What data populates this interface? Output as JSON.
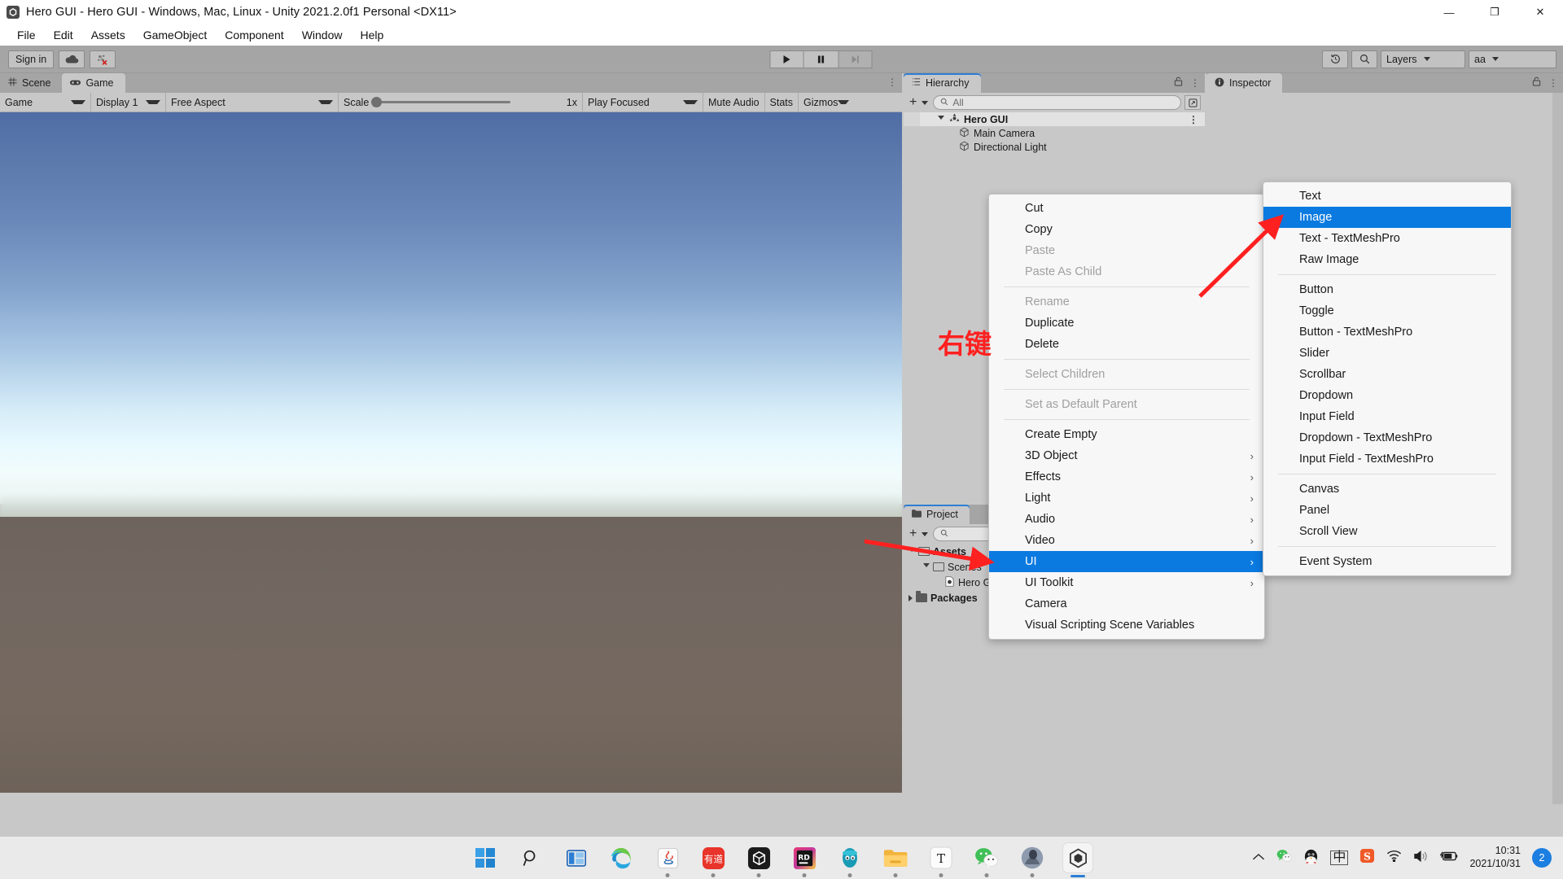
{
  "window": {
    "title": "Hero GUI - Hero GUI - Windows, Mac, Linux - Unity 2021.2.0f1 Personal <DX11>",
    "app_icon": "unity-icon",
    "minimize": "—",
    "maximize": "❐",
    "close": "✕"
  },
  "menubar": {
    "items": [
      {
        "label": "File"
      },
      {
        "label": "Edit"
      },
      {
        "label": "Assets"
      },
      {
        "label": "GameObject"
      },
      {
        "label": "Component"
      },
      {
        "label": "Window"
      },
      {
        "label": "Help"
      }
    ]
  },
  "toolbar": {
    "signin_label": "Sign in",
    "cloud_icon": "cloud-icon",
    "collab_icon": "collab-error-icon",
    "play_icon": "play-icon",
    "pause_icon": "pause-icon",
    "step_icon": "step-icon",
    "history_icon": "undo-history-icon",
    "search_icon": "search-icon",
    "layers_label": "Layers",
    "layout_label": "aa"
  },
  "game_view": {
    "tabs": [
      {
        "label": "Scene",
        "icon": "grid-icon",
        "active": false
      },
      {
        "label": "Game",
        "icon": "gamepad-icon",
        "active": true
      }
    ],
    "toolbar": {
      "target_display_mode": "Game",
      "display": "Display 1",
      "aspect": "Free Aspect",
      "scale_label": "Scale",
      "scale_value": "1x",
      "play_mode": "Play Focused",
      "mute_audio": "Mute Audio",
      "stats": "Stats",
      "gizmos": "Gizmos"
    },
    "sky_color_top": "#4f6da5",
    "sky_color_horizon": "#eafaff",
    "ground_color": "#726761"
  },
  "hierarchy": {
    "tab_label": "Hierarchy",
    "tab_icon": "hierarchy-icon",
    "lock_icon": "lock-icon",
    "menu_icon": "kebab-icon",
    "add_label": "+",
    "search_placeholder": "All",
    "items": [
      {
        "label": "Hero GUI",
        "icon": "scene-icon",
        "depth": 0,
        "expanded": true,
        "is_scene": true
      },
      {
        "label": "Main Camera",
        "icon": "gameobject-icon",
        "depth": 1,
        "expanded": false,
        "is_scene": false
      },
      {
        "label": "Directional Light",
        "icon": "gameobject-icon",
        "depth": 1,
        "expanded": false,
        "is_scene": false
      }
    ]
  },
  "project": {
    "tab_label": "Project",
    "tab_icon": "folder-icon",
    "add_label": "+",
    "search_placeholder": "",
    "items": [
      {
        "label": "Assets",
        "depth": 0,
        "expanded": true,
        "icon": "folder-open-icon"
      },
      {
        "label": "Scenes",
        "depth": 1,
        "expanded": true,
        "icon": "folder-open-icon"
      },
      {
        "label": "Hero GUI",
        "depth": 2,
        "expanded": false,
        "icon": "unity-scene-asset-icon"
      },
      {
        "label": "Packages",
        "depth": 0,
        "expanded": false,
        "icon": "folder-icon"
      }
    ]
  },
  "inspector": {
    "tab_label": "Inspector",
    "tab_icon": "info-icon",
    "lock_icon": "lock-icon",
    "menu_icon": "kebab-icon"
  },
  "context_menu": {
    "items": [
      {
        "label": "Cut",
        "enabled": true,
        "submenu": false,
        "selected": false
      },
      {
        "label": "Copy",
        "enabled": true,
        "submenu": false,
        "selected": false
      },
      {
        "label": "Paste",
        "enabled": false,
        "submenu": false,
        "selected": false
      },
      {
        "label": "Paste As Child",
        "enabled": false,
        "submenu": false,
        "selected": false
      },
      {
        "separator": true
      },
      {
        "label": "Rename",
        "enabled": false,
        "submenu": false,
        "selected": false
      },
      {
        "label": "Duplicate",
        "enabled": true,
        "submenu": false,
        "selected": false
      },
      {
        "label": "Delete",
        "enabled": true,
        "submenu": false,
        "selected": false
      },
      {
        "separator": true
      },
      {
        "label": "Select Children",
        "enabled": false,
        "submenu": false,
        "selected": false
      },
      {
        "separator": true
      },
      {
        "label": "Set as Default Parent",
        "enabled": false,
        "submenu": false,
        "selected": false
      },
      {
        "separator": true
      },
      {
        "label": "Create Empty",
        "enabled": true,
        "submenu": false,
        "selected": false
      },
      {
        "label": "3D Object",
        "enabled": true,
        "submenu": true,
        "selected": false
      },
      {
        "label": "Effects",
        "enabled": true,
        "submenu": true,
        "selected": false
      },
      {
        "label": "Light",
        "enabled": true,
        "submenu": true,
        "selected": false
      },
      {
        "label": "Audio",
        "enabled": true,
        "submenu": true,
        "selected": false
      },
      {
        "label": "Video",
        "enabled": true,
        "submenu": true,
        "selected": false
      },
      {
        "label": "UI",
        "enabled": true,
        "submenu": true,
        "selected": true
      },
      {
        "label": "UI Toolkit",
        "enabled": true,
        "submenu": true,
        "selected": false
      },
      {
        "label": "Camera",
        "enabled": true,
        "submenu": false,
        "selected": false
      },
      {
        "label": "Visual Scripting Scene Variables",
        "enabled": true,
        "submenu": false,
        "selected": false
      }
    ]
  },
  "ui_submenu": {
    "items": [
      {
        "label": "Text",
        "selected": false
      },
      {
        "label": "Image",
        "selected": true
      },
      {
        "label": "Text - TextMeshPro",
        "selected": false
      },
      {
        "label": "Raw Image",
        "selected": false
      },
      {
        "separator": true
      },
      {
        "label": "Button",
        "selected": false
      },
      {
        "label": "Toggle",
        "selected": false
      },
      {
        "label": "Button - TextMeshPro",
        "selected": false
      },
      {
        "label": "Slider",
        "selected": false
      },
      {
        "label": "Scrollbar",
        "selected": false
      },
      {
        "label": "Dropdown",
        "selected": false
      },
      {
        "label": "Input Field",
        "selected": false
      },
      {
        "label": "Dropdown - TextMeshPro",
        "selected": false
      },
      {
        "label": "Input Field - TextMeshPro",
        "selected": false
      },
      {
        "separator": true
      },
      {
        "label": "Canvas",
        "selected": false
      },
      {
        "label": "Panel",
        "selected": false
      },
      {
        "label": "Scroll View",
        "selected": false
      },
      {
        "separator": true
      },
      {
        "label": "Event System",
        "selected": false
      }
    ]
  },
  "annotations": {
    "right_click_label": "右键",
    "arrow_color": "#ff2020"
  },
  "taskbar": {
    "icons": [
      {
        "name": "start-windows-icon",
        "running": false
      },
      {
        "name": "search-icon",
        "running": false
      },
      {
        "name": "task-view-icon",
        "running": false
      },
      {
        "name": "microsoft-edge-icon",
        "running": true
      },
      {
        "name": "java-icon",
        "running": true
      },
      {
        "name": "youdao-dictionary-icon",
        "running": true
      },
      {
        "name": "unity-hub-icon",
        "running": true
      },
      {
        "name": "rider-icon",
        "running": true
      },
      {
        "name": "navicat-icon",
        "running": true
      },
      {
        "name": "file-explorer-icon",
        "running": true
      },
      {
        "name": "typora-icon",
        "running": true
      },
      {
        "name": "wechat-icon",
        "running": true
      },
      {
        "name": "photo-app-icon",
        "running": true
      },
      {
        "name": "unity-editor-icon",
        "running": true,
        "active": true
      }
    ],
    "tray": {
      "chevron_icon": "show-hidden-icons-icon",
      "wechat_icon": "wechat-tray-icon",
      "qq_icon": "qq-tray-icon",
      "ime_icon": "中",
      "sogou_icon": "sogou-input-icon",
      "wifi_icon": "wifi-icon",
      "volume_icon": "volume-icon",
      "battery_icon": "battery-charging-icon",
      "time": "10:31",
      "date": "2021/10/31",
      "notification_count": "2"
    }
  }
}
